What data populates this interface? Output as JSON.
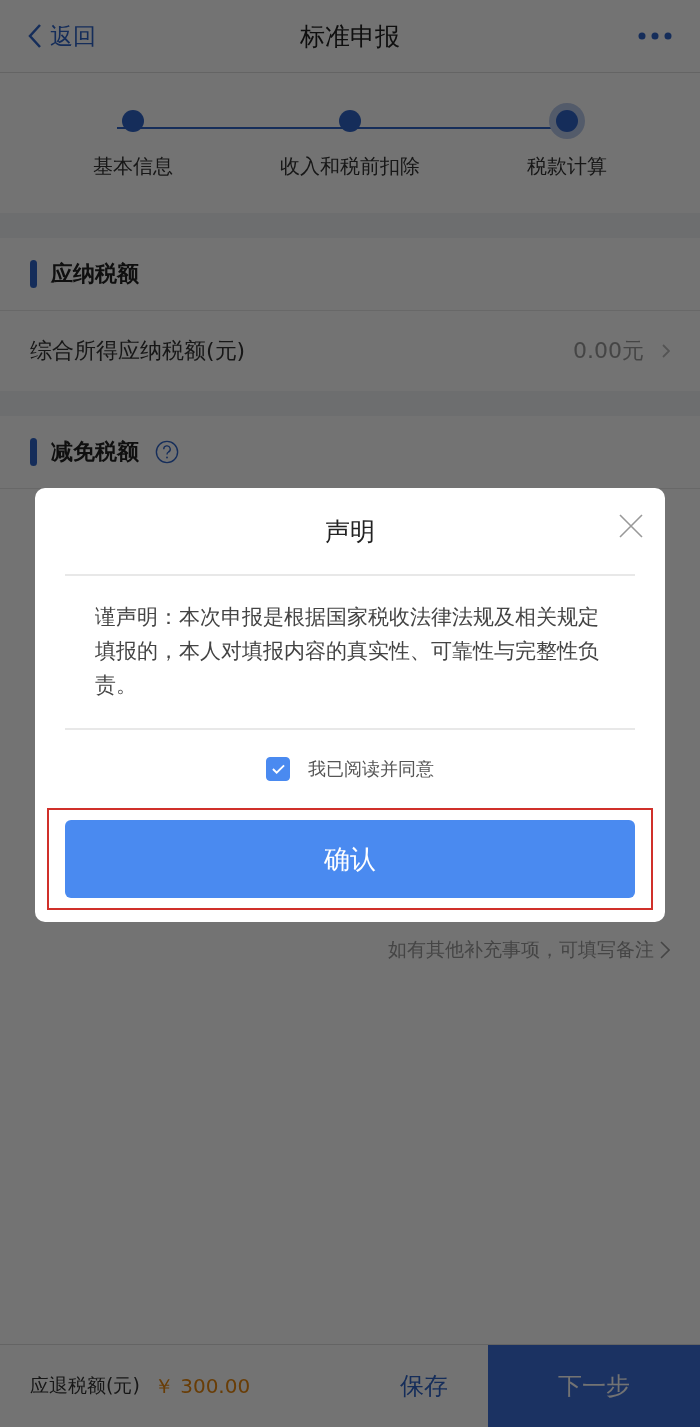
{
  "nav": {
    "back": "返回",
    "title": "标准申报"
  },
  "steps": [
    {
      "label": "基本信息",
      "selected": false
    },
    {
      "label": "收入和税前扣除",
      "selected": false
    },
    {
      "label": "税款计算",
      "selected": true
    }
  ],
  "sections": [
    {
      "title": "应纳税额",
      "rows": [
        {
          "label": "综合所得应纳税额(元)",
          "value": "0.00元"
        }
      ]
    },
    {
      "title": "减免税额",
      "help": true
    }
  ],
  "remark_link": "如有其他补充事项，可填写备注",
  "bottom_bar": {
    "label": "应退税额(元)",
    "amount": "￥ 300.00",
    "save": "保存",
    "next": "下一步"
  },
  "dialog": {
    "title": "声明",
    "body": "谨声明：本次申报是根据国家税收法律法规及相关规定填报的，本人对填报内容的真实性、可靠性与完整性负责。",
    "agree": {
      "label": "我已阅读并同意",
      "checked": true
    },
    "confirm": {
      "label": "确认",
      "highlighted": true
    }
  }
}
